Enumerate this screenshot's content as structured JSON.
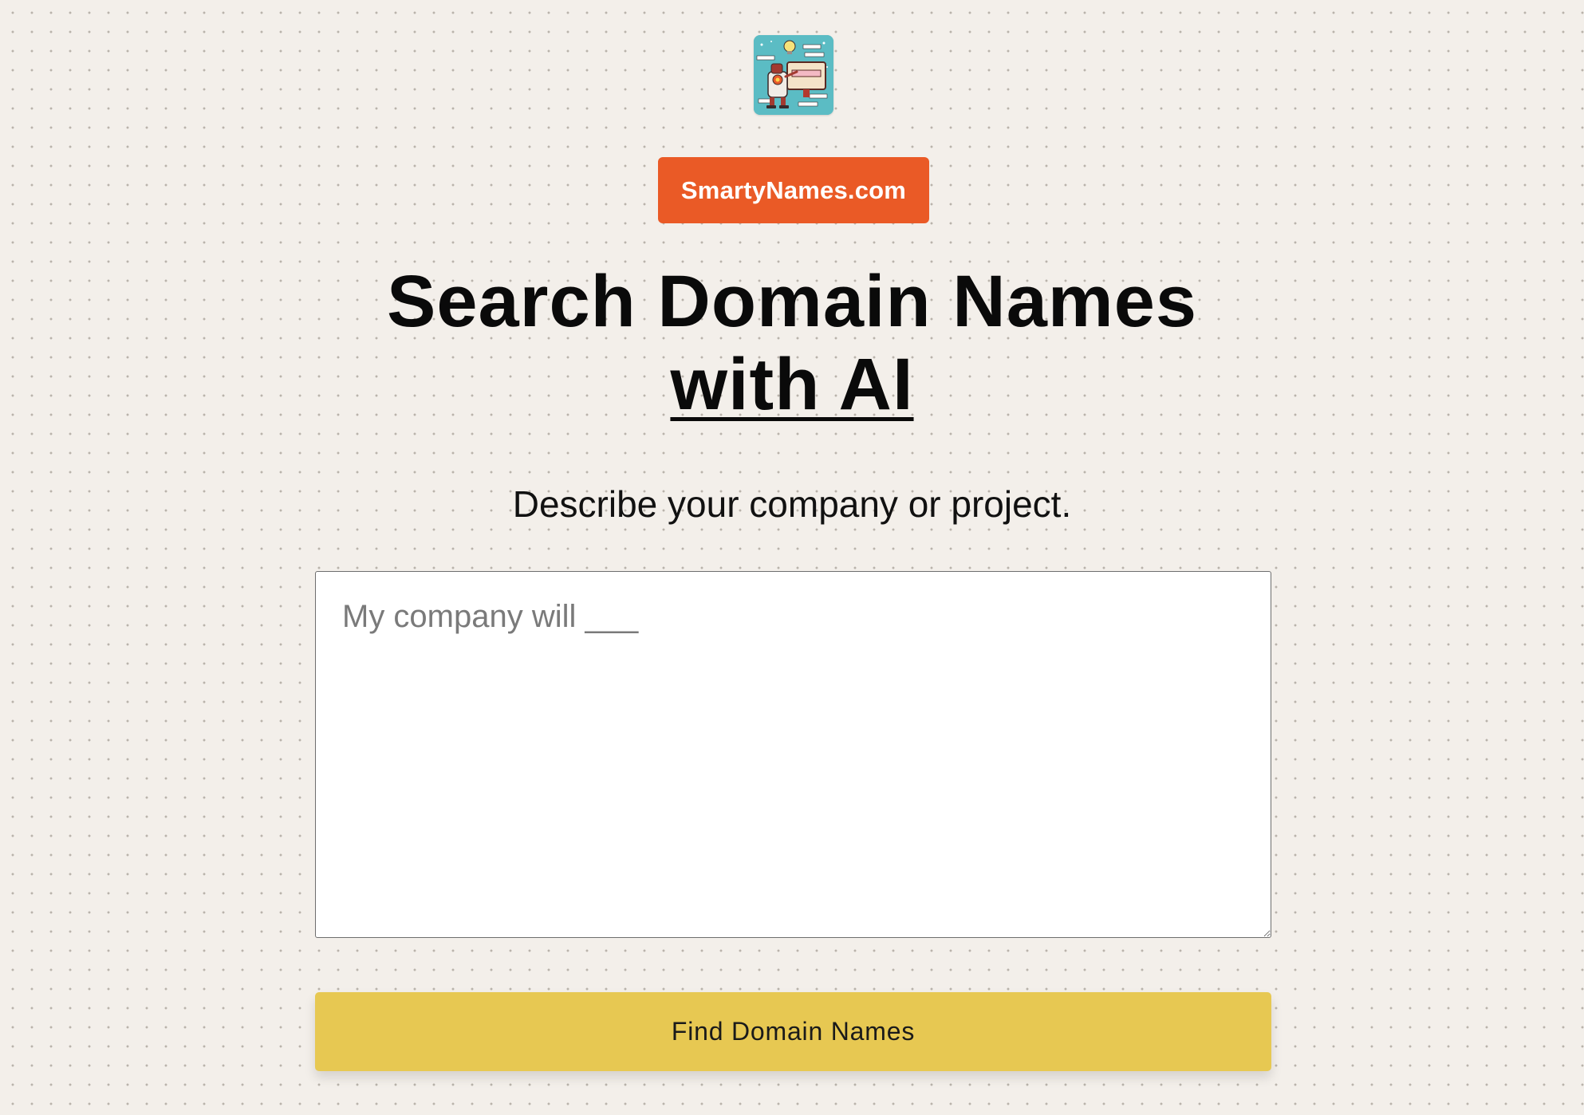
{
  "logo": {
    "icon": "robot-mascot-logo-icon"
  },
  "brand": {
    "label": "SmartyNames.com",
    "color": "#ea5a26"
  },
  "hero": {
    "title_line1": "Search Domain Names",
    "title_line2": "with AI",
    "subtitle": "Describe your company or project."
  },
  "form": {
    "description": {
      "placeholder": "My company will ___",
      "value": ""
    },
    "submit_label": "Find Domain Names",
    "submit_color": "#e7c852"
  },
  "theme": {
    "background": "#f3efea"
  }
}
